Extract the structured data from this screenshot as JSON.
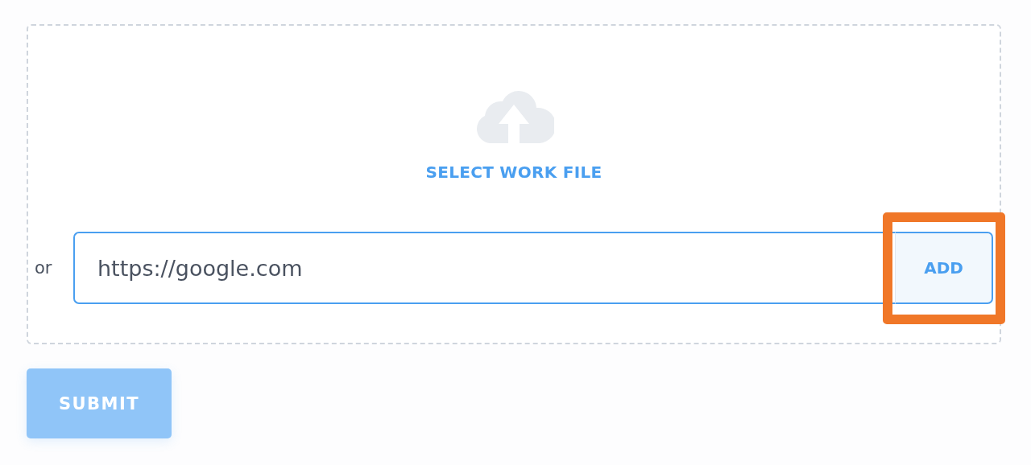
{
  "upload": {
    "label": "SELECT WORK FILE"
  },
  "url_row": {
    "prefix": "or",
    "value": "https://google.com",
    "add_button": "ADD",
    "highlighted": true
  },
  "submit": {
    "label": "SUBMIT",
    "disabled": true
  }
}
